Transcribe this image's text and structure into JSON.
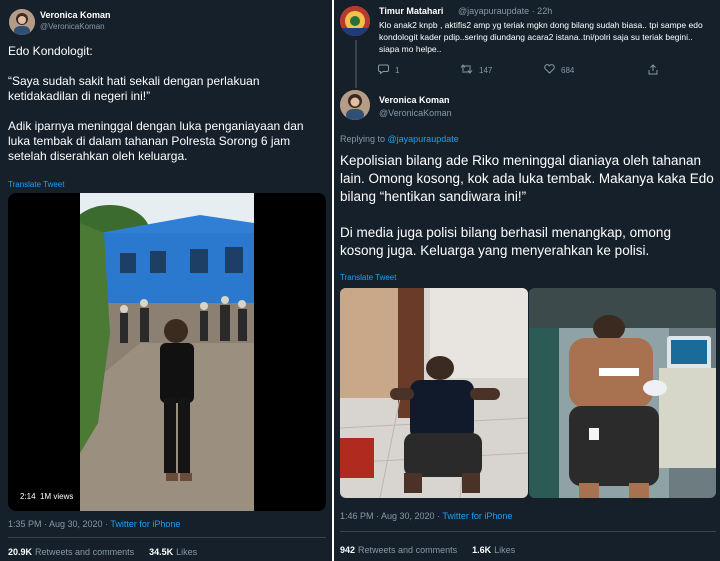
{
  "left_tweet": {
    "author_name": "Veronica Koman",
    "author_handle": "@VeronicaKoman",
    "text_lines": [
      "Edo Kondologit:",
      "“Saya sudah sakit hati sekali dengan perlakuan ketidakadilan di negeri ini!”",
      "Adik iparnya meninggal dengan luka penganiayaan dan luka tembak di dalam tahanan Polresta Sorong 6 jam setelah diserahkan oleh keluarga."
    ],
    "translate_label": "Translate Tweet",
    "video": {
      "duration": "2:14",
      "views": "1M views"
    },
    "timestamp": "1:35 PM · Aug 30, 2020 · ",
    "source": "Twitter for iPhone",
    "retweets_count": "20.9K",
    "retweets_label": "Retweets and comments",
    "likes_count": "34.5K",
    "likes_label": "Likes"
  },
  "parent_tweet": {
    "author_name": "Timur Matahari",
    "author_handle": "@jayapuraupdate · 22h",
    "text": "Klo anak2 knpb , aktifis2 amp yg teriak mgkn dong bilang sudah biasa.. tpi sampe edo kondologit kader pdip..sering diundang acara2 istana..tni/polri saja su teriak begini.. siapa mo helpe..",
    "reply_count": "1",
    "retweet_count": "147",
    "like_count": "684"
  },
  "right_tweet": {
    "author_name": "Veronica Koman",
    "author_handle": "@VeronicaKoman",
    "replying_prefix": "Replying to ",
    "replying_to": "@jayapuraupdate",
    "paragraph1": "Kepolisian bilang ade Riko meninggal dianiaya oleh tahanan lain. Omong kosong, kok ada luka tembak. Makanya kaka Edo bilang “hentikan sandiwara ini!”",
    "paragraph2": "Di media juga polisi bilang berhasil menangkap, omong kosong juga. Keluarga yang menyerahkan ke polisi.",
    "translate_label": "Translate Tweet",
    "timestamp": "1:46 PM · Aug 30, 2020 · ",
    "source": "Twitter for iPhone",
    "retweets_count": "942",
    "retweets_label": "Retweets and comments",
    "likes_count": "1.6K",
    "likes_label": "Likes"
  },
  "colors": {
    "background": "#15202b",
    "link": "#1da1f2",
    "secondary_text": "#8899a6",
    "divider": "#38444d"
  },
  "icons": [
    "reply-icon",
    "retweet-icon",
    "like-icon",
    "share-icon"
  ]
}
